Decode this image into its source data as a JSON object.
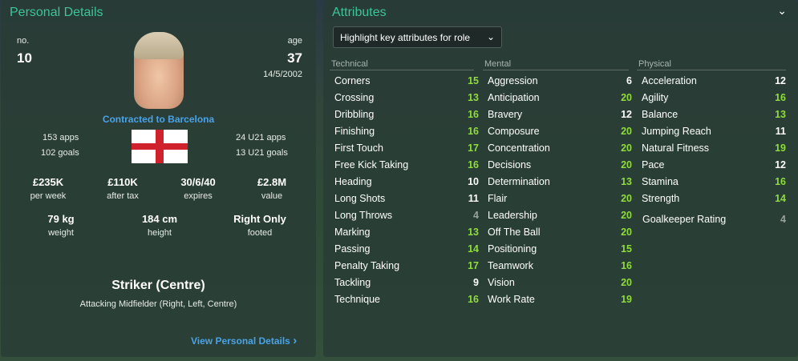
{
  "personal": {
    "title": "Personal Details",
    "no_label": "no.",
    "no_value": "10",
    "age_label": "age",
    "age_value": "37",
    "dob": "14/5/2002",
    "contract": "Contracted to Barcelona",
    "apps": "153 apps",
    "goals": "102 goals",
    "u21_apps": "24 U21 apps",
    "u21_goals": "13 U21 goals",
    "stats": [
      {
        "value": "£235K",
        "label": "per week"
      },
      {
        "value": "£110K",
        "label": "after tax"
      },
      {
        "value": "30/6/40",
        "label": "expires"
      },
      {
        "value": "£2.8M",
        "label": "value"
      }
    ],
    "physical": [
      {
        "value": "79 kg",
        "label": "weight"
      },
      {
        "value": "184 cm",
        "label": "height"
      },
      {
        "value": "Right Only",
        "label": "footed"
      }
    ],
    "position": "Striker (Centre)",
    "secondary_position": "Attacking Midfielder (Right, Left, Centre)",
    "view_link": "View Personal Details",
    "link_chevron": "›"
  },
  "attributes": {
    "title": "Attributes",
    "collapse_glyph": "⌄",
    "dropdown_label": "Highlight key attributes for role",
    "dropdown_chevron": "⌄",
    "technical_head": "Technical",
    "mental_head": "Mental",
    "physical_head": "Physical",
    "technical": [
      {
        "name": "Corners",
        "value": "15"
      },
      {
        "name": "Crossing",
        "value": "13"
      },
      {
        "name": "Dribbling",
        "value": "16"
      },
      {
        "name": "Finishing",
        "value": "16"
      },
      {
        "name": "First Touch",
        "value": "17"
      },
      {
        "name": "Free Kick Taking",
        "value": "16"
      },
      {
        "name": "Heading",
        "value": "10"
      },
      {
        "name": "Long Shots",
        "value": "11"
      },
      {
        "name": "Long Throws",
        "value": "4"
      },
      {
        "name": "Marking",
        "value": "13"
      },
      {
        "name": "Passing",
        "value": "14"
      },
      {
        "name": "Penalty Taking",
        "value": "17"
      },
      {
        "name": "Tackling",
        "value": "9"
      },
      {
        "name": "Technique",
        "value": "16"
      }
    ],
    "mental": [
      {
        "name": "Aggression",
        "value": "6"
      },
      {
        "name": "Anticipation",
        "value": "20"
      },
      {
        "name": "Bravery",
        "value": "12"
      },
      {
        "name": "Composure",
        "value": "20"
      },
      {
        "name": "Concentration",
        "value": "20"
      },
      {
        "name": "Decisions",
        "value": "20"
      },
      {
        "name": "Determination",
        "value": "13"
      },
      {
        "name": "Flair",
        "value": "20"
      },
      {
        "name": "Leadership",
        "value": "20"
      },
      {
        "name": "Off The Ball",
        "value": "20"
      },
      {
        "name": "Positioning",
        "value": "15"
      },
      {
        "name": "Teamwork",
        "value": "16"
      },
      {
        "name": "Vision",
        "value": "20"
      },
      {
        "name": "Work Rate",
        "value": "19"
      }
    ],
    "physical": [
      {
        "name": "Acceleration",
        "value": "12"
      },
      {
        "name": "Agility",
        "value": "16"
      },
      {
        "name": "Balance",
        "value": "13"
      },
      {
        "name": "Jumping Reach",
        "value": "11"
      },
      {
        "name": "Natural Fitness",
        "value": "19"
      },
      {
        "name": "Pace",
        "value": "12"
      },
      {
        "name": "Stamina",
        "value": "16"
      },
      {
        "name": "Strength",
        "value": "14"
      }
    ],
    "goalkeeper": {
      "name": "Goalkeeper Rating",
      "value": "4"
    }
  },
  "colors": {
    "accent": "#3ec39a",
    "link": "#4aa3e8",
    "high": "#8fdc3c",
    "low": "#9aa29e"
  }
}
